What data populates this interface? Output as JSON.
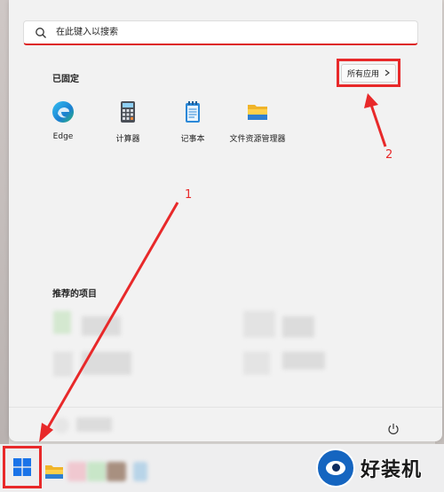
{
  "search": {
    "placeholder": "在此键入以搜索"
  },
  "pinned": {
    "title": "已固定",
    "all_apps_label": "所有应用",
    "apps": [
      {
        "label": "Edge",
        "icon": "edge-icon"
      },
      {
        "label": "计算器",
        "icon": "calculator-icon"
      },
      {
        "label": "记事本",
        "icon": "notepad-icon"
      },
      {
        "label": "文件资源管理器",
        "icon": "file-explorer-icon"
      }
    ]
  },
  "recommended": {
    "title": "推荐的项目"
  },
  "annotations": {
    "arrow1": "1",
    "arrow2": "2"
  },
  "watermark": {
    "text": "好装机"
  },
  "colors": {
    "accent_red": "#e8292a",
    "windows_blue": "#1a73e8"
  }
}
